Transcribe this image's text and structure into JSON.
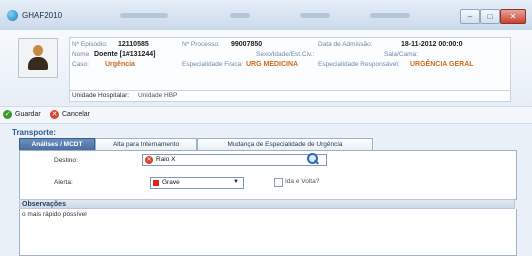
{
  "window": {
    "title": "GHAF2010",
    "minimize": "–",
    "maximize": "□",
    "close": "✕"
  },
  "patient": {
    "episode_label": "Nº Episódio:",
    "episode_value": "12110585",
    "process_label": "Nº Processo:",
    "process_value": "99007850",
    "admission_label": "Data de Admissão:",
    "admission_value": "18-11-2012 00:00:0",
    "patient_label": "Nome",
    "patient_value": "Doente [1#131244]",
    "sex_label": "Sexo/Idade/Est.Civ.:",
    "bed_label": "Sala/Cama:",
    "case_label": "Caso:",
    "case_value": "Urgência",
    "specialty_label": "Especialidade Fisica:",
    "specialty_value": "URG MEDICINA",
    "responsible_label": "Especialidade Responsável:",
    "responsible_value": "URGÊNCIA GERAL",
    "hospital_label": "Unidade Hospitalar:",
    "hospital_value": "Unidade HBP"
  },
  "toolbar": {
    "save_label": "Guardar",
    "cancel_label": "Cancelar"
  },
  "section": {
    "title": "Transporte:"
  },
  "tabs": [
    {
      "label": "Análises / MCDT"
    },
    {
      "label": "Alta para Internamento"
    },
    {
      "label": "Mudança de Especialidade de Urgência"
    }
  ],
  "form": {
    "destination_label": "Destino:",
    "destination_value": "Raio X",
    "alert_label": "Alerta:",
    "alert_value": "Grave",
    "alert_color": "#e0231b",
    "round_trip_label": "Ida e Volta?"
  },
  "observations": {
    "title": "Observações",
    "text": "o mais rápido possível"
  },
  "colors": {
    "accent": "#2d5a8f",
    "orange_value": "#d06a1a",
    "active_tab": "#4a6f9f"
  }
}
